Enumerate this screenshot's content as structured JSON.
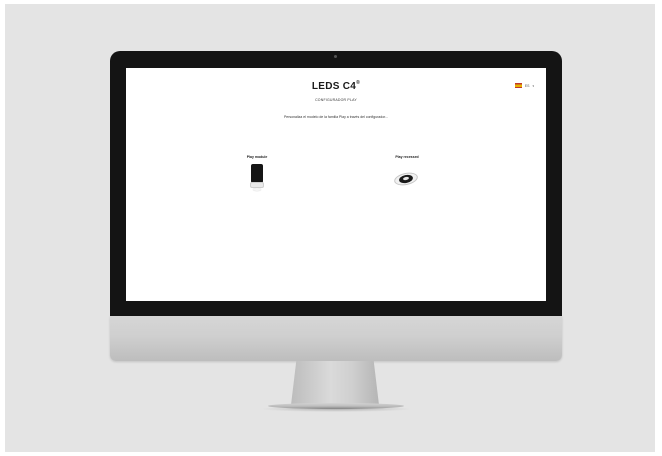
{
  "header": {
    "logo_text": "LEDS C4",
    "logo_mark": "®",
    "subtitle": "CONFIGURADOR PLAY",
    "intro": "Personaliza el modelo de la familia Play a través del configurador..."
  },
  "language": {
    "flag_icon": "spain-flag-icon",
    "label": "ES",
    "chevron": "chevron-down-icon"
  },
  "products": [
    {
      "name": "Play module",
      "icon": "spotlight-module-icon"
    },
    {
      "name": "Play recessed",
      "icon": "recessed-downlight-icon"
    }
  ]
}
